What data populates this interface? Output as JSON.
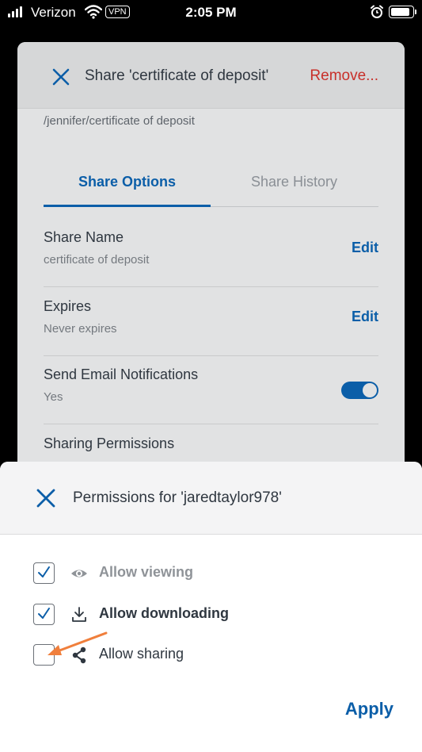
{
  "status_bar": {
    "carrier": "Verizon",
    "vpn": "VPN",
    "time": "2:05 PM",
    "battery_level": 0.9
  },
  "dialog": {
    "title": "Share 'certificate of deposit'",
    "remove_label": "Remove...",
    "path": "/jennifer/certificate of deposit",
    "tabs": [
      {
        "label": "Share Options",
        "active": true
      },
      {
        "label": "Share History",
        "active": false
      }
    ],
    "options": [
      {
        "label": "Share Name",
        "value": "certificate of deposit",
        "action": "Edit"
      },
      {
        "label": "Expires",
        "value": "Never expires",
        "action": "Edit"
      },
      {
        "label": "Send Email Notifications",
        "value": "Yes",
        "toggle_on": true
      },
      {
        "label": "Sharing Permissions"
      }
    ]
  },
  "sheet": {
    "title": "Permissions for 'jaredtaylor978'",
    "permissions": [
      {
        "label": "Allow viewing",
        "checked": true,
        "icon": "eye-icon"
      },
      {
        "label": "Allow downloading",
        "checked": true,
        "icon": "download-icon"
      },
      {
        "label": "Allow sharing",
        "checked": false,
        "icon": "share-icon"
      }
    ],
    "apply_label": "Apply"
  },
  "colors": {
    "accent": "#0b5ea8",
    "danger": "#c8302a",
    "annotation_arrow": "#f07f3c"
  }
}
